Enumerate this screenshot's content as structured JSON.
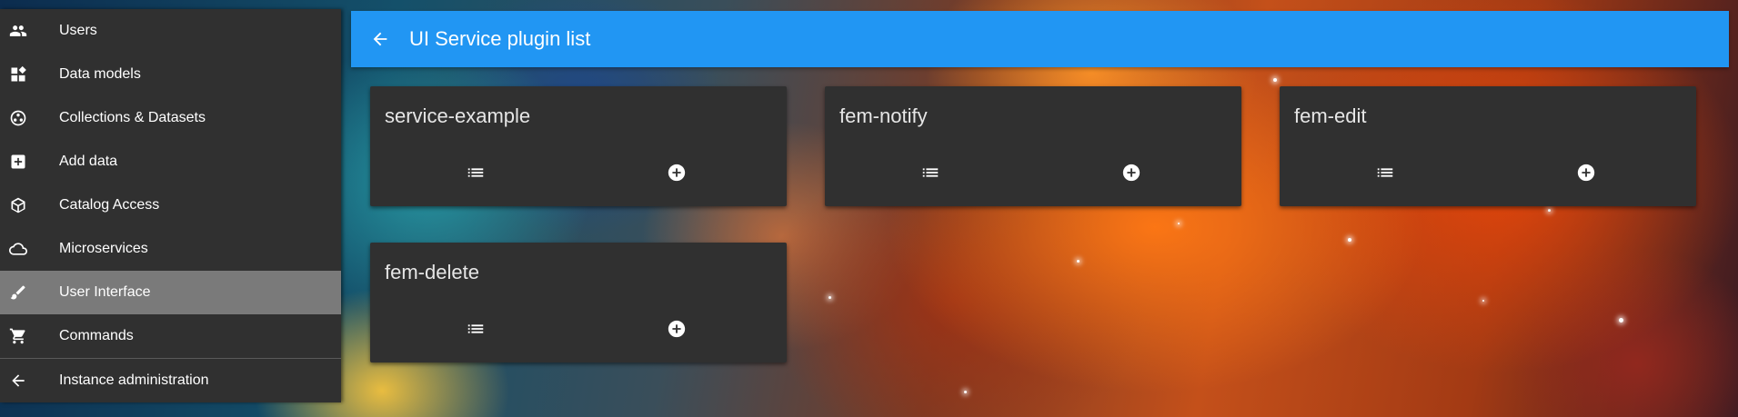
{
  "sidebar": {
    "items": [
      {
        "label": "Users",
        "icon": "users-icon"
      },
      {
        "label": "Data models",
        "icon": "dashboard-icon"
      },
      {
        "label": "Collections & Datasets",
        "icon": "collections-icon"
      },
      {
        "label": "Add data",
        "icon": "add-box-icon"
      },
      {
        "label": "Catalog Access",
        "icon": "cube-icon"
      },
      {
        "label": "Microservices",
        "icon": "cloud-icon"
      },
      {
        "label": "User Interface",
        "icon": "brush-icon",
        "active": true
      },
      {
        "label": "Commands",
        "icon": "cart-icon"
      },
      {
        "label": "Instance administration",
        "icon": "arrow-back-icon"
      }
    ]
  },
  "header": {
    "title": "UI Service plugin list",
    "back_icon": "arrow-back-icon",
    "color": "#2196f3"
  },
  "cards": [
    {
      "title": "service-example",
      "list_icon": "list-icon",
      "add_icon": "add-circle-icon"
    },
    {
      "title": "fem-notify",
      "list_icon": "list-icon",
      "add_icon": "add-circle-icon"
    },
    {
      "title": "fem-edit",
      "list_icon": "list-icon",
      "add_icon": "add-circle-icon"
    },
    {
      "title": "fem-delete",
      "list_icon": "list-icon",
      "add_icon": "add-circle-icon"
    }
  ],
  "colors": {
    "sidebar_bg": "#303030",
    "active_item_bg": "#7a7a7a",
    "card_bg": "#303030"
  }
}
